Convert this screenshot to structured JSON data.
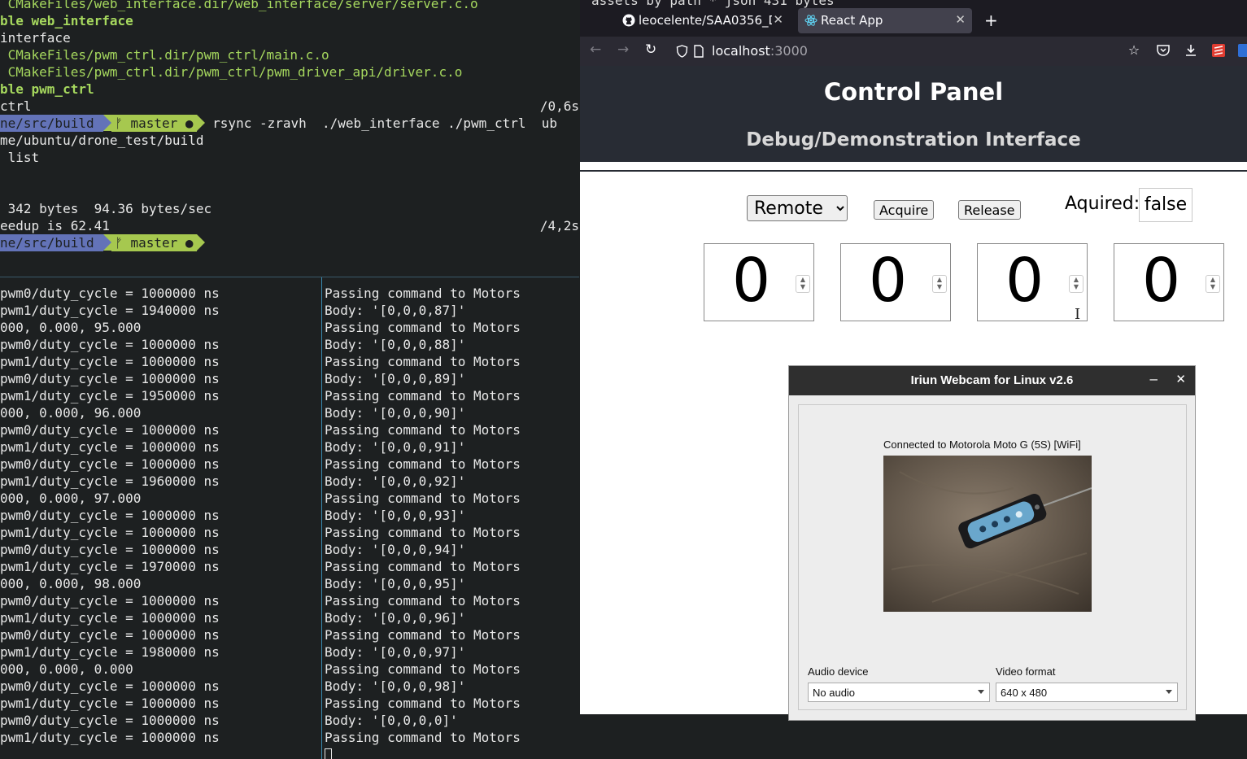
{
  "terminal_top": {
    "lines": [
      {
        "text": " CMakeFiles/web_interface.dir/web_interface/server/server.c.o",
        "style": "green"
      },
      {
        "text": "ble web_interface",
        "style": "green-bold"
      },
      {
        "text": "interface",
        "style": "plain"
      },
      {
        "text": " CMakeFiles/pwm_ctrl.dir/pwm_ctrl/main.c.o",
        "style": "green"
      },
      {
        "text": " CMakeFiles/pwm_ctrl.dir/pwm_ctrl/pwm_driver_api/driver.c.o",
        "style": "green"
      },
      {
        "text": "ble pwm_ctrl",
        "style": "green-bold"
      },
      {
        "text": "ctrl",
        "style": "plain",
        "right": "/0,6s"
      },
      {
        "prompt": true,
        "path": "ne/src/build ",
        "branch": "ᚠ master ●",
        "command": " rsync -zravh  ./web_interface ./pwm_ctrl  ub"
      },
      {
        "text": "me/ubuntu/drone_test/build",
        "style": "plain"
      },
      {
        "text": " list",
        "style": "plain"
      },
      {
        "text": "",
        "style": "plain"
      },
      {
        "text": "",
        "style": "plain"
      },
      {
        "text": " 342 bytes  94.36 bytes/sec",
        "style": "plain"
      },
      {
        "text": "eedup is 62.41",
        "style": "plain",
        "right": "/4,2s"
      },
      {
        "prompt": true,
        "path": "ne/src/build ",
        "branch": "ᚠ master ●",
        "command": ""
      }
    ]
  },
  "terminal_left": {
    "lines": [
      "pwm0/duty_cycle = 1000000 ns",
      "pwm1/duty_cycle = 1940000 ns",
      "000, 0.000, 95.000",
      "pwm0/duty_cycle = 1000000 ns",
      "pwm1/duty_cycle = 1000000 ns",
      "pwm0/duty_cycle = 1000000 ns",
      "pwm1/duty_cycle = 1950000 ns",
      "000, 0.000, 96.000",
      "pwm0/duty_cycle = 1000000 ns",
      "pwm1/duty_cycle = 1000000 ns",
      "pwm0/duty_cycle = 1000000 ns",
      "pwm1/duty_cycle = 1960000 ns",
      "000, 0.000, 97.000",
      "pwm0/duty_cycle = 1000000 ns",
      "pwm1/duty_cycle = 1000000 ns",
      "pwm0/duty_cycle = 1000000 ns",
      "pwm1/duty_cycle = 1970000 ns",
      "000, 0.000, 98.000",
      "pwm0/duty_cycle = 1000000 ns",
      "pwm1/duty_cycle = 1000000 ns",
      "pwm0/duty_cycle = 1000000 ns",
      "pwm1/duty_cycle = 1980000 ns",
      "000, 0.000, 0.000",
      "pwm0/duty_cycle = 1000000 ns",
      "pwm1/duty_cycle = 1000000 ns",
      "pwm0/duty_cycle = 1000000 ns",
      "pwm1/duty_cycle = 1000000 ns"
    ]
  },
  "terminal_right": {
    "lines": [
      "Passing command to Motors",
      "Body: '[0,0,0,87]'",
      "Passing command to Motors",
      "Body: '[0,0,0,88]'",
      "Passing command to Motors",
      "Body: '[0,0,0,89]'",
      "Passing command to Motors",
      "Body: '[0,0,0,90]'",
      "Passing command to Motors",
      "Body: '[0,0,0,91]'",
      "Passing command to Motors",
      "Body: '[0,0,0,92]'",
      "Passing command to Motors",
      "Body: '[0,0,0,93]'",
      "Passing command to Motors",
      "Body: '[0,0,0,94]'",
      "Passing command to Motors",
      "Body: '[0,0,0,95]'",
      "Passing command to Motors",
      "Body: '[0,0,0,96]'",
      "Passing command to Motors",
      "Body: '[0,0,0,97]'",
      "Passing command to Motors",
      "Body: '[0,0,0,98]'",
      "Passing command to Motors",
      "Body: '[0,0,0,0]'",
      "Passing command to Motors"
    ]
  },
  "browser": {
    "peek_text": "assets by path * json 431 bytes",
    "tabs": [
      {
        "label": "leocelente/SAA0356_D",
        "icon": "github-icon",
        "active": false
      },
      {
        "label": "React App",
        "icon": "react-icon",
        "active": true
      }
    ],
    "url_host": "localhost",
    "url_port": ":3000",
    "app": {
      "title": "Control Panel",
      "subtitle": "Debug/Demonstration Interface",
      "mode_selected": "Remote",
      "mode_options": [
        "Remote"
      ],
      "acquire_label": "Acquire",
      "release_label": "Release",
      "aquired_label": "Aquired:",
      "aquired_value": "false",
      "motor_values": [
        "0",
        "0",
        "0",
        "0"
      ]
    }
  },
  "webcam": {
    "title": "Iriun Webcam for Linux v2.6",
    "status": "Connected to Motorola Moto G (5S) [WiFi]",
    "audio_label": "Audio device",
    "audio_value": "No audio",
    "video_label": "Video format",
    "video_value": "640 x 480"
  },
  "colors": {
    "terminal_bg": "#1d2021",
    "prompt_path": "#6373b8",
    "prompt_git": "#a6c84f",
    "header_bg": "#282c34",
    "browser_chrome": "#1c1b22"
  }
}
